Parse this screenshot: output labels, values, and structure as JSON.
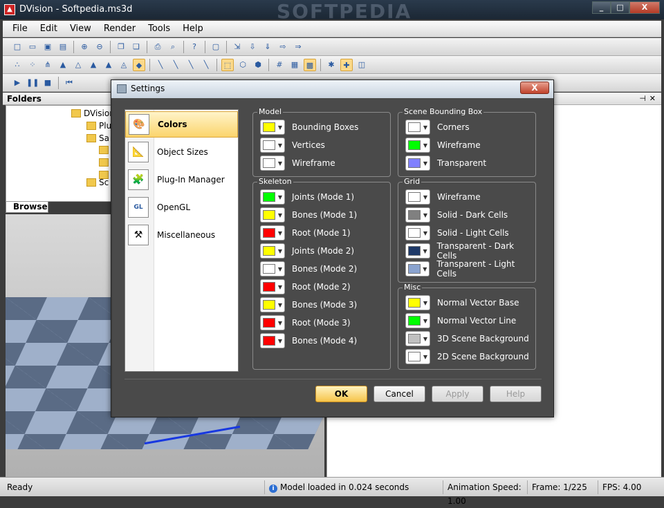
{
  "window": {
    "title": "DVision - Softpedia.ms3d",
    "watermark": "SOFTPEDIA",
    "controls": [
      "_",
      "□",
      "X"
    ]
  },
  "menu": [
    "File",
    "Edit",
    "View",
    "Render",
    "Tools",
    "Help"
  ],
  "folders": {
    "title": "Folders",
    "items": [
      "DVision",
      "Plu",
      "Sa",
      "Sc"
    ],
    "tab": "Browse"
  },
  "dialog": {
    "title": "Settings",
    "close": "X",
    "nav": [
      {
        "label": "Colors",
        "icon": "palette-icon",
        "glyph": "🎨"
      },
      {
        "label": "Object Sizes",
        "icon": "ruler-icon",
        "glyph": "📐"
      },
      {
        "label": "Plug-In Manager",
        "icon": "puzzle-icon",
        "glyph": "🧩"
      },
      {
        "label": "OpenGL",
        "icon": "opengl-icon",
        "glyph": "GL"
      },
      {
        "label": "Miscellaneous",
        "icon": "tools-icon",
        "glyph": "⚒"
      }
    ],
    "groups": {
      "model": {
        "title": "Model",
        "items": [
          {
            "label": "Bounding Boxes",
            "color": "#ffff00"
          },
          {
            "label": "Vertices",
            "color": "#ffffff"
          },
          {
            "label": "Wireframe",
            "color": "#ffffff"
          }
        ]
      },
      "scene_bbox": {
        "title": "Scene Bounding Box",
        "items": [
          {
            "label": "Corners",
            "color": "#ffffff"
          },
          {
            "label": "Wireframe",
            "color": "#00ff00"
          },
          {
            "label": "Transparent",
            "color": "#8080ff"
          }
        ]
      },
      "skeleton": {
        "title": "Skeleton",
        "items": [
          {
            "label": "Joints (Mode 1)",
            "color": "#00ff00"
          },
          {
            "label": "Bones (Mode 1)",
            "color": "#ffff00"
          },
          {
            "label": "Root (Mode 1)",
            "color": "#ff0000"
          },
          {
            "label": "Joints (Mode 2)",
            "color": "#ffff00"
          },
          {
            "label": "Bones (Mode 2)",
            "color": "#ffffff"
          },
          {
            "label": "Root (Mode 2)",
            "color": "#ff0000"
          },
          {
            "label": "Bones (Mode 3)",
            "color": "#ffff00"
          },
          {
            "label": "Root (Mode 3)",
            "color": "#ff0000"
          },
          {
            "label": "Bones (Mode 4)",
            "color": "#ff0000"
          }
        ]
      },
      "grid": {
        "title": "Grid",
        "items": [
          {
            "label": "Wireframe",
            "color": "#ffffff"
          },
          {
            "label": "Solid - Dark Cells",
            "color": "#808080"
          },
          {
            "label": "Solid - Light Cells",
            "color": "#ffffff"
          },
          {
            "label": "Transparent - Dark Cells",
            "color": "#1f3a68"
          },
          {
            "label": "Transparent - Light Cells",
            "color": "#8aa3cf"
          }
        ]
      },
      "misc": {
        "title": "Misc",
        "items": [
          {
            "label": "Normal Vector Base",
            "color": "#ffff00"
          },
          {
            "label": "Normal Vector Line",
            "color": "#00ff00"
          },
          {
            "label": "3D Scene Background",
            "color": "#c0c0c0"
          },
          {
            "label": "2D Scene Background",
            "color": "#ffffff"
          }
        ]
      }
    },
    "buttons": {
      "ok": "OK",
      "cancel": "Cancel",
      "apply": "Apply",
      "help": "Help"
    }
  },
  "status": {
    "left": "Ready",
    "message": "Model loaded in 0.024 seconds",
    "info_glyph": "i",
    "anim_speed": "Animation Speed: 1.00",
    "frame": "Frame: 1/225",
    "fps": "FPS: 4.00"
  }
}
